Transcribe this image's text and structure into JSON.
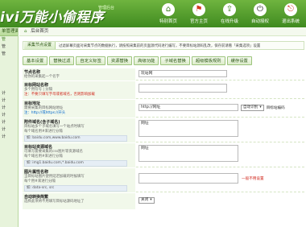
{
  "header": {
    "logo": "ivi万能小偷程序",
    "logo_sup": "管理后台",
    "nav": [
      {
        "label": "特别首页",
        "icon": "home-icon",
        "glyph": "⌂"
      },
      {
        "label": "官方主页",
        "icon": "flag-icon",
        "glyph": "⚑"
      },
      {
        "label": "在线升级",
        "icon": "upgrade-icon",
        "glyph": "⇪"
      },
      {
        "label": "自动授权",
        "icon": "power-icon",
        "glyph": "⏻"
      },
      {
        "label": "退出系统",
        "icon": "exit-icon",
        "glyph": "⎋"
      }
    ]
  },
  "sidebar": {
    "title": "单管理面板",
    "items": [
      "",
      "",
      "",
      "",
      "",
      "",
      "",
      "",
      "",
      "",
      "",
      "",
      "",
      "",
      "",
      "",
      "",
      "",
      "",
      "",
      ""
    ],
    "labels": [
      "管",
      "管",
      "管",
      "计",
      "计",
      "计",
      "计",
      "计",
      "计",
      "计"
    ]
  },
  "breadcrumb": {
    "home": "⌂",
    "text": "后台首页"
  },
  "tip": {
    "tab": "采集节点设置",
    "msg": "过滤屏幕页面对采集节点的数据执行，请按照采集前的页面源代码进行编写，不要目标站源码乱改，保存前请看「采集选项」设置",
    "hl": "采集选项"
  },
  "tabs": [
    "基本设置",
    "替换过滤",
    "自定义标签",
    "资源替换",
    "高级功能",
    "子域名替换",
    "超级模板规则",
    "缓存设置"
  ],
  "form": {
    "site_name": {
      "title": "节点名称",
      "desc": "给你的采集起一个名字",
      "value": "玩站网"
    },
    "target_url": {
      "title": "目标网站名称",
      "desc": "多个用符号 | 分隔",
      "warn": "注：不要只填写字母或者域名，否则影响加载",
      "value": ""
    },
    "target_addr": {
      "title": "目标地址",
      "desc": "需要采集的目标网站地址",
      "note": "注：http://或https://开头",
      "value": "http://网址",
      "charset": "自动识别",
      "charset_label": "目标站编码"
    },
    "sub_domain": {
      "title": "附件域名(含子域名)",
      "desc": "目标站多个子域名填写一个站点时填写",
      "desc2": "每个域名用#来进行分隔",
      "example": "如: baidu.com,www.baidu.com",
      "value": "网址"
    },
    "sub_url": {
      "title": "目标站资源域名",
      "desc": "可填写需要采集的css图片等资源域名",
      "desc2": "每个域名用#来进行分隔",
      "example": "如: img1.baidu.com,*.baidu.com",
      "value": "网址"
    },
    "img_attr": {
      "title": "图片属性名称",
      "desc": "当目标站图片使用延迟加载的时候填写",
      "desc2": "每个用#来进行分隔",
      "example": "如: data-src, src",
      "value": "",
      "note": "一般不用设置"
    },
    "auto_convert": {
      "title": "自动转换简繁",
      "desc": "选择此项将不用填写目标站源码地址了",
      "value": "关闭"
    }
  }
}
